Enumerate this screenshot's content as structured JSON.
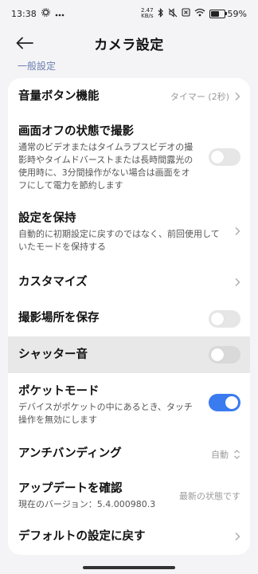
{
  "status": {
    "time": "13:38",
    "net_speed_value": "2.47",
    "net_speed_unit": "KB/s",
    "battery_percent": "59%",
    "battery_level": 0.59
  },
  "header": {
    "title": "カメラ設定"
  },
  "section": {
    "title": "一般設定"
  },
  "rows": {
    "volume": {
      "title": "音量ボタン機能",
      "value": "タイマー (2秒)"
    },
    "screen_off": {
      "title": "画面オフの状態で撮影",
      "desc1": "通常のビデオまたはタイムラプスビデオの撮",
      "desc2": "影時やタイムドバーストまたは長時間露光の",
      "desc3": "使用時に、3分間操作がない場合は画面をオ",
      "desc4": "フにして電力を節約します",
      "enabled": false
    },
    "keep_settings": {
      "title": "設定を保持",
      "desc1": "自動的に初期設定に戻すのではなく、前回使用して",
      "desc2": "いたモードを保持する"
    },
    "customize": {
      "title": "カスタマイズ"
    },
    "save_location": {
      "title": "撮影場所を保存",
      "enabled": false
    },
    "shutter_sound": {
      "title": "シャッター音",
      "enabled": false
    },
    "pocket_mode": {
      "title": "ポケットモード",
      "desc1": "デバイスがポケットの中にあるとき、タッチ",
      "desc2": "操作を無効にします",
      "enabled": true
    },
    "antibanding": {
      "title": "アンチバンディング",
      "value": "自動"
    },
    "update": {
      "title": "アップデートを確認",
      "desc": "現在のバージョン：5.4.000980.3",
      "value": "最新の状態です"
    },
    "reset": {
      "title": "デフォルトの設定に戻す"
    }
  },
  "colors": {
    "accent": "#3a7bf0",
    "section_title": "#6b7fb0",
    "background": "#f4f4f6"
  }
}
